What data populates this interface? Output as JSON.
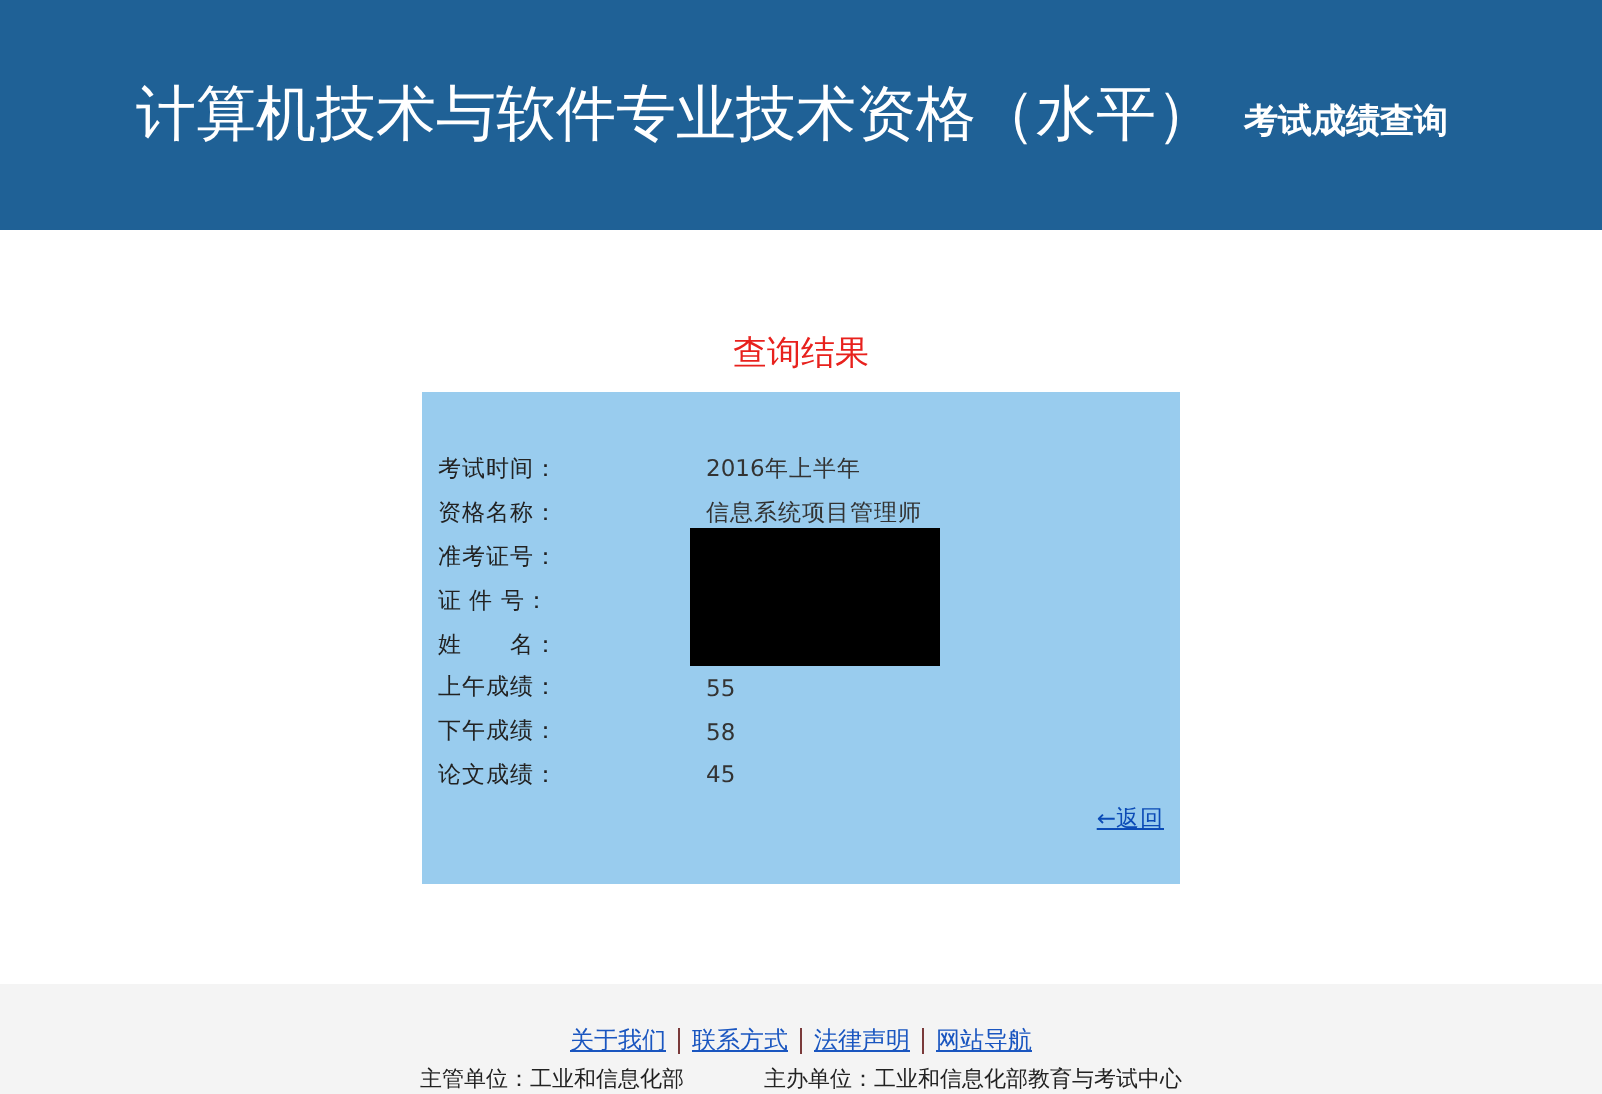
{
  "header": {
    "title": "计算机技术与软件专业技术资格（水平）",
    "subtitle": "考试成绩查询"
  },
  "result": {
    "heading": "查询结果",
    "rows": [
      {
        "label": "考试时间：",
        "value": "2016年上半年"
      },
      {
        "label": "资格名称：",
        "value": "信息系统项目管理师"
      },
      {
        "label": "准考证号：",
        "redacted": true
      },
      {
        "label": "证 件 号：",
        "redacted": true
      },
      {
        "label": "姓　　名：",
        "redacted": true
      },
      {
        "label": "上午成绩：",
        "value": "55"
      },
      {
        "label": "下午成绩：",
        "value": "58"
      },
      {
        "label": "论文成绩：",
        "value": "45"
      }
    ],
    "back_link": "←返回"
  },
  "footer": {
    "links": [
      "关于我们",
      "联系方式",
      "法律声明",
      "网站导航"
    ],
    "credits": [
      "主管单位：工业和信息化部",
      "主办单位：工业和信息化部教育与考试中心"
    ]
  }
}
